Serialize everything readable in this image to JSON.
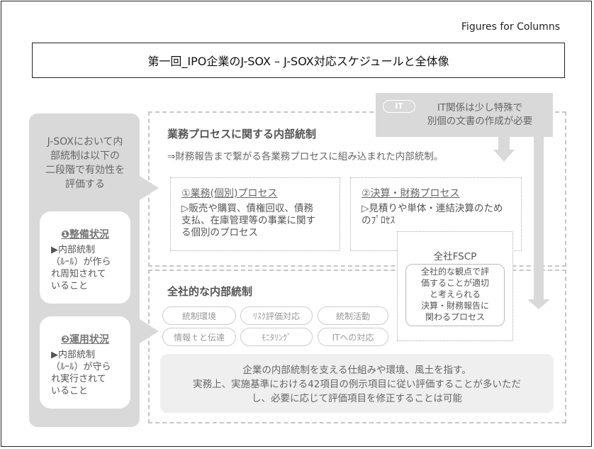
{
  "caption": "Figures for Columns",
  "title": "第一回_IPO企業のJ-SOX – J-SOX対応スケジュールと全体像",
  "left": {
    "intro": [
      "J-SOXにおいて内",
      "部統制は以下の",
      "二段階で有効性を",
      "評価する"
    ],
    "card1": {
      "title": "❶整備状況",
      "body": [
        "▶内部統制",
        "（ﾙｰﾙ）が作ら",
        "れ周知されて",
        "いること"
      ]
    },
    "card2": {
      "title": "❷運用状況",
      "body": [
        "▶内部統制",
        "（ﾙｰﾙ）が守ら",
        "れ実行されて",
        "いること"
      ]
    }
  },
  "it": {
    "badge": "IT",
    "text": [
      "IT関係は少し特殊で",
      "別個の文書の作成が必要"
    ]
  },
  "business": {
    "title": "業務プロセスに関する内部統制",
    "subtitle": "⇒財務報告まで繋がる各業務プロセスに組み込まれた内部統制。",
    "box1": {
      "title": "①業務(個別)プロセス",
      "body": [
        "▷販売や購買、債権回収、債務",
        "支払、在庫管理等の事業に関す",
        "る個別のプロセス"
      ]
    },
    "box2": {
      "title": "②決算・財務プロセス",
      "body": [
        "▷見積りや単体・連結決算のため",
        "のﾌﾟﾛｾｽ"
      ]
    }
  },
  "fscp": {
    "title": "全社FSCP",
    "desc": [
      "全社的な観点で評",
      "価することが適切",
      "と考えられる",
      "決算・財務報告に",
      "関わるプロセス"
    ]
  },
  "entity": {
    "title": "全社的な内部統制",
    "pills": [
      "統制環境",
      "ﾘｽｸ評価対応",
      "統制活動",
      "情報ｔと伝達",
      "ﾓﾆﾀﾘﾝｸﾞ",
      "ITへの対応"
    ],
    "note": [
      "企業の内部統制を支える仕組みや環境、風土を指す。",
      "実務上、実施基準における42項目の例示項目に従い評価することが多いただ",
      "し、必要に応じて評価項目を修正することは可能"
    ]
  },
  "colors": {
    "panel_gray": "#d9d9d9",
    "dash_gray": "#c6c6c6",
    "note_bg": "#efefef"
  }
}
